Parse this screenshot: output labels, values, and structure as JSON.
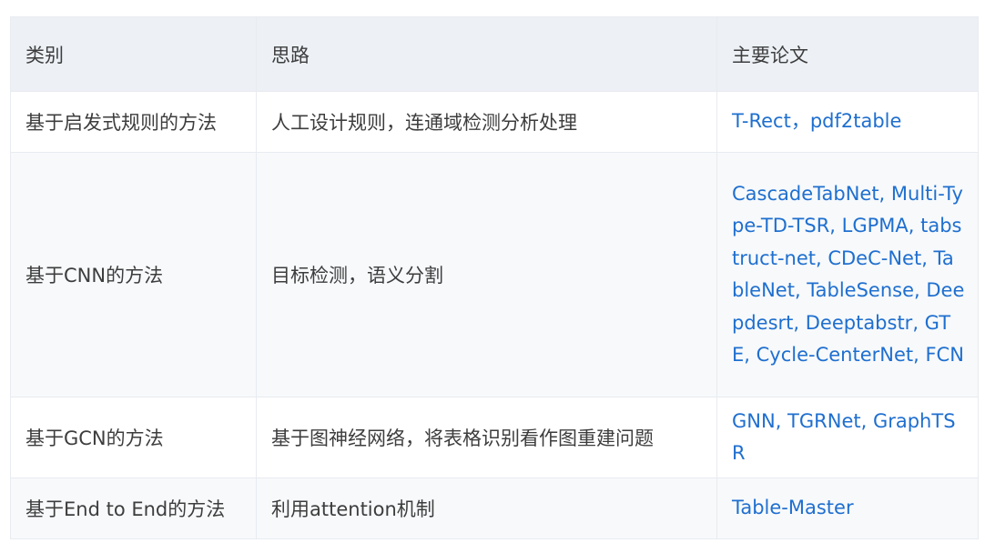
{
  "table": {
    "headers": [
      "类别",
      "思路",
      "主要论文"
    ],
    "rows": [
      {
        "category": "基于启发式规则的方法",
        "idea": "人工设计规则，连通域检测分析处理",
        "papers": "T-Rect，pdf2table"
      },
      {
        "category": "基于CNN的方法",
        "idea": "目标检测，语义分割",
        "papers": "CascadeTabNet, Multi-Type-TD-TSR, LGPMA, tabstruct-net, CDeC-Net, TableNet, TableSense, Deepdesrt, Deeptabstr, GTE, Cycle-CenterNet, FCN"
      },
      {
        "category": "基于GCN的方法",
        "idea": "基于图神经网络，将表格识别看作图重建问题",
        "papers": "GNN, TGRNet, GraphTSR"
      },
      {
        "category": "基于End to End的方法",
        "idea": "利用attention机制",
        "papers": "Table-Master"
      }
    ]
  },
  "colors": {
    "header_bg": "#edf1f6",
    "link": "#1f6fcf",
    "text": "#3d3d3d",
    "border": "#e8ebf0",
    "row_alt_bg": "#f7f9fb"
  }
}
